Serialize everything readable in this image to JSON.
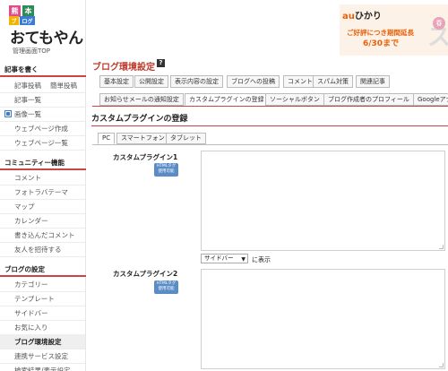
{
  "logo": {
    "box1": "熊",
    "box2": "本",
    "box3": "ブ",
    "box4": "ログ",
    "main": "おてもやん",
    "admin_top": "管理画面TOP"
  },
  "sidebar": {
    "write_head": "記事を書く",
    "write_items": [
      "記事投稿",
      "簡単投稿",
      "記事一覧",
      "画像一覧",
      "ウェブページ作成",
      "ウェブページ一覧"
    ],
    "community_head": "コミュニティー機能",
    "community_items": [
      "コメント",
      "フォトラバテーマ",
      "マップ",
      "カレンダー",
      "書き込んだコメント",
      "友人を招待する"
    ],
    "blog_head": "ブログの設定",
    "blog_items": [
      "カテゴリー",
      "テンプレート",
      "サイドバー",
      "お気に入り",
      "ブログ環境設定",
      "連携サービス設定",
      "検索結果/表示設定"
    ]
  },
  "ad": {
    "brand_a": "au",
    "brand_b": "ひかり",
    "line1": "ご好評につき期間延長",
    "line2": "6/30まで",
    "deco": "ス",
    "badge": "春"
  },
  "page": {
    "title": "ブログ環境設定",
    "help": "?"
  },
  "tabs_row1": [
    "基本設定",
    "公開設定",
    "表示内容の設定",
    "ブログへの投稿",
    "コメント",
    "スパム対策",
    "関連記事"
  ],
  "tabs_row2": [
    "お知らせメールの通知設定",
    "カスタムプラグインの登録",
    "ソーシャルボタン",
    "ブログ作成者のプロフィール",
    "Googleアナ"
  ],
  "section": {
    "title": "カスタムプラグインの登録"
  },
  "inner_tabs": [
    "PC",
    "スマートフォン",
    "タブレット"
  ],
  "plugins": [
    {
      "label": "カスタムプラグイン1",
      "badge": "HTMLタグ 使用可能",
      "value": ""
    },
    {
      "label": "カスタムプラグイン2",
      "badge": "HTMLタグ 使用可能",
      "value": ""
    }
  ],
  "position": {
    "selected": "サイドバー",
    "suffix": "に表示"
  },
  "colors": {
    "accent": "#c0392b",
    "ad_orange": "#e8610a",
    "badge_blue": "#5b8cc6"
  }
}
